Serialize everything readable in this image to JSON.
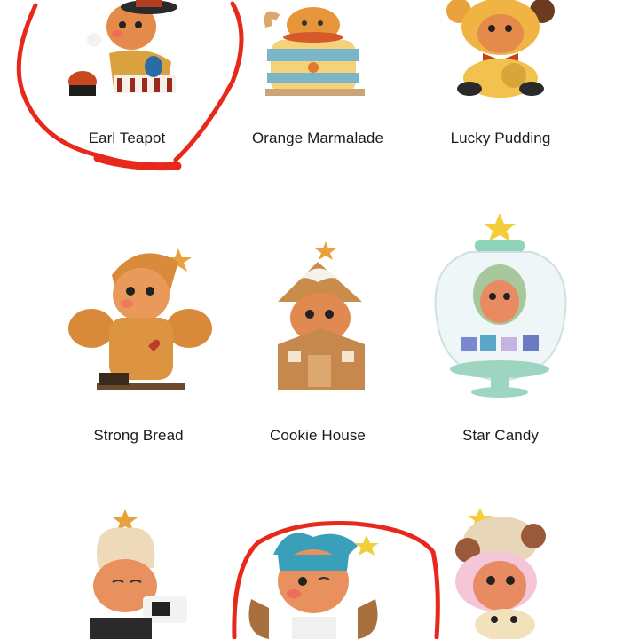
{
  "products": [
    {
      "name": "Earl Teapot"
    },
    {
      "name": "Orange Marmalade"
    },
    {
      "name": "Lucky Pudding"
    },
    {
      "name": "Strong Bread"
    },
    {
      "name": "Cookie House"
    },
    {
      "name": "Star Candy"
    },
    {
      "name": "",
      "icon": "gingerbread-chef-figure"
    },
    {
      "name": "",
      "icon": "gingerbread-bandana-figure"
    },
    {
      "name": "",
      "icon": "gingerbread-icecream-figure"
    }
  ],
  "annotation": {
    "color": "#e8281c"
  }
}
